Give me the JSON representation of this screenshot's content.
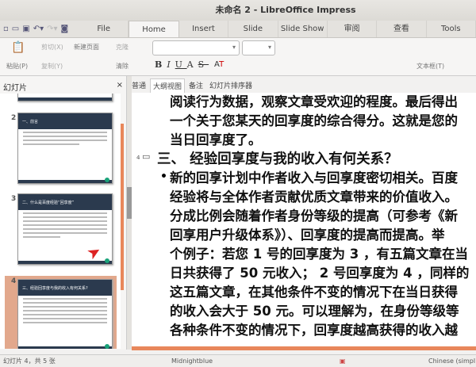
{
  "window": {
    "title": "未命名 2 - LibreOffice Impress"
  },
  "menu_tabs": [
    "File",
    "Home",
    "Insert",
    "Slide",
    "Slide Show",
    "审阅",
    "查看",
    "Tools"
  ],
  "ribbon": {
    "paste": "粘贴(P)",
    "cut": "剪切(X)",
    "copy": "复制(Y)",
    "new_slide": "新建页面",
    "clone": "克隆",
    "clear": "清除",
    "textbox": "文本框(T)",
    "font_name": "",
    "font_size": ""
  },
  "view_tabs": [
    "普通",
    "大纲视图",
    "备注",
    "幻灯片排序器"
  ],
  "slides_panel": {
    "title": "幻灯片",
    "close": "×",
    "slides": [
      {
        "number": "2",
        "title": "一、前言"
      },
      {
        "number": "3",
        "title": "二、什么是百度经验“回享度”"
      },
      {
        "number": "4",
        "title": "三、经验回享度与我的收入有何关系?"
      }
    ]
  },
  "outline": {
    "prev_lines": [
      "阅读行为数据，观察文章受欢迎的程度。最后得出",
      "一个关于您某天的回享度的综合得分。这就是您的",
      "当日回享度了。"
    ],
    "slide_number": "4",
    "heading": "三、 经验回享度与我的收入有何关系？",
    "bullet_lines": [
      "新的回享计划中作者收入与回享度密切相关。百度",
      "经验将与全体作者贡献优质文章带来的价值收入。",
      "分成比例会随着作者身份等级的提高（可参考《新",
      "回享用户升级体系》）、回享度的提高而提高。举",
      "个例子：若您 1 号的回享度为 3 ，有五篇文章在当",
      "日共获得了 50 元收入； 2 号回享度为 4 ，同样的",
      "这五篇文章，在其他条件不变的情况下在当日获得",
      "的收入会大于 50 元。可以理解为，在身份等级等",
      "各种条件不变的情况下，回享度越高获得的收入越"
    ]
  },
  "status": {
    "slide_info": "幻灯片 4，共 5 张",
    "theme": "Midnightblue",
    "language": "Chinese (simpl"
  },
  "colors": {
    "accent": "#e8875b",
    "slide_header": "#2b3a4e"
  }
}
